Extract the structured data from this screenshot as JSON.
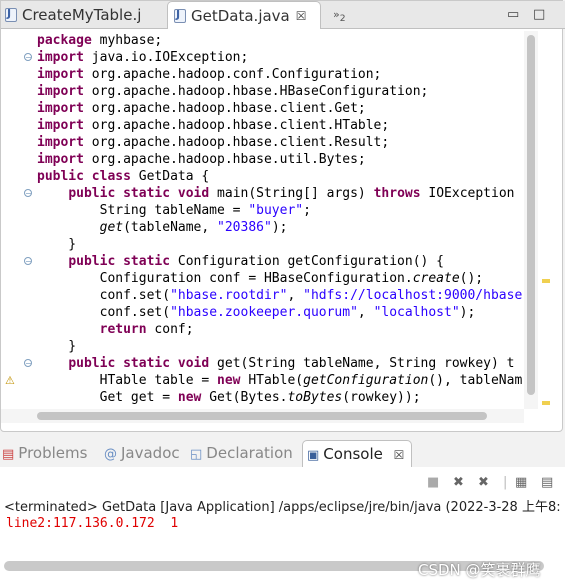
{
  "editor": {
    "tabs": [
      {
        "label": "CreateMyTable.j",
        "active": false
      },
      {
        "label": "GetData.java",
        "active": true
      }
    ],
    "tab_close": "☒",
    "overflow_label": "»",
    "overflow_count": "2",
    "minimize": "▭",
    "maximize": "□",
    "code_lines": [
      "package myhbase;",
      "import java.io.IOException;",
      "import org.apache.hadoop.conf.Configuration;",
      "import org.apache.hadoop.hbase.HBaseConfiguration;",
      "import org.apache.hadoop.hbase.client.Get;",
      "import org.apache.hadoop.hbase.client.HTable;",
      "import org.apache.hadoop.hbase.client.Result;",
      "import org.apache.hadoop.hbase.util.Bytes;",
      "public class GetData {",
      "    public static void main(String[] args) throws IOException",
      "        String tableName = \"buyer\";",
      "        get(tableName, \"20386\");",
      "    }",
      "    public static Configuration getConfiguration() {",
      "        Configuration conf = HBaseConfiguration.create();",
      "        conf.set(\"hbase.rootdir\", \"hdfs://localhost:9000/hbase",
      "        conf.set(\"hbase.zookeeper.quorum\", \"localhost\");",
      "        return conf;",
      "    }",
      "    public static void get(String tableName, String rowkey) t",
      "        HTable table = new HTable(getConfiguration(), tableNam",
      "        Get get = new Get(Bytes.toBytes(rowkey));"
    ]
  },
  "views": {
    "tabs": [
      {
        "label": "Problems",
        "icon": "problems-icon"
      },
      {
        "label": "Javadoc",
        "icon": "javadoc-icon"
      },
      {
        "label": "Declaration",
        "icon": "declaration-icon"
      },
      {
        "label": "Console",
        "icon": "console-icon"
      }
    ],
    "close": "☒"
  },
  "console": {
    "status": "<terminated> GetData [Java Application] /apps/eclipse/jre/bin/java (2022-3-28 上午8:",
    "output": "line2:117.136.0.172  1"
  },
  "watermark": "CSDN @笑裹群鹰",
  "colors": {
    "keyword": "#7f0055",
    "string": "#2a00ff",
    "console_output": "#e00000"
  }
}
